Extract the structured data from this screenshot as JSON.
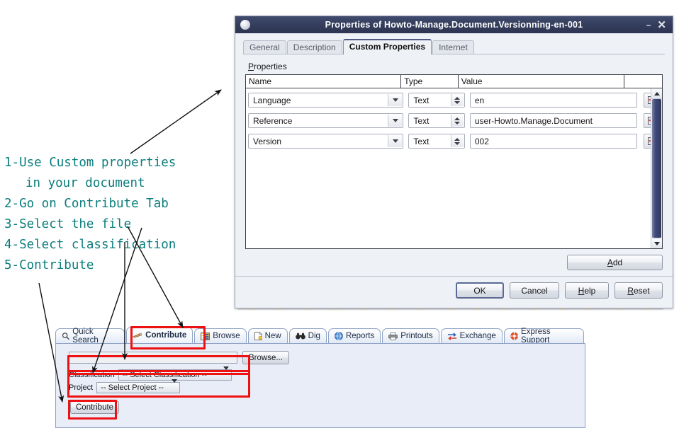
{
  "annotations": {
    "lines": [
      "1-Use Custom properties",
      "in your document",
      "2-Go on Contribute Tab",
      "3-Select the file",
      "4-Select classification",
      "5-Contribute"
    ],
    "color": "#0b7d7d"
  },
  "dialog": {
    "title": "Properties of Howto-Manage.Document.Versionning-en-001",
    "window_icon": "document-icon",
    "minimize_label": "–",
    "close_label": "✕",
    "tabs": [
      {
        "label": "General",
        "active": false
      },
      {
        "label": "Description",
        "active": false
      },
      {
        "label": "Custom Properties",
        "active": true
      },
      {
        "label": "Internet",
        "active": false
      }
    ],
    "group_label": "Properties",
    "group_label_mnemonic": "P",
    "columns": [
      "Name",
      "Type",
      "Value",
      ""
    ],
    "rows": [
      {
        "name": "Language",
        "type": "Text",
        "value": "en"
      },
      {
        "name": "Reference",
        "type": "Text",
        "value": "user-Howto.Manage.Document"
      },
      {
        "name": "Version",
        "type": "Text",
        "value": "002"
      }
    ],
    "row_button_icon": "grid-table-icon",
    "add_label": "Add",
    "add_mnemonic": "A",
    "footer_buttons": [
      {
        "label": "OK",
        "mnemonic": "",
        "default": true
      },
      {
        "label": "Cancel",
        "mnemonic": "",
        "default": false
      },
      {
        "label": "Help",
        "mnemonic": "H",
        "default": false
      },
      {
        "label": "Reset",
        "mnemonic": "R",
        "default": false
      }
    ],
    "scrollbar": {
      "up_icon": "scroll-up-arrow-icon",
      "down_icon": "scroll-down-arrow-icon"
    }
  },
  "app": {
    "tabs": [
      {
        "label": "Quick Search",
        "icon": "magnifier-icon",
        "active": false
      },
      {
        "label": "Contribute",
        "icon": "pencil-icon",
        "active": true
      },
      {
        "label": "Browse",
        "icon": "list-icon",
        "active": false
      },
      {
        "label": "New",
        "icon": "new-document-icon",
        "active": false
      },
      {
        "label": "Dig",
        "icon": "binoculars-icon",
        "active": false
      },
      {
        "label": "Reports",
        "icon": "globe-icon",
        "active": false
      },
      {
        "label": "Printouts",
        "icon": "printer-icon",
        "active": false
      },
      {
        "label": "Exchange",
        "icon": "exchange-arrows-icon",
        "active": false
      },
      {
        "label": "Express Support",
        "icon": "lifebuoy-icon",
        "active": false
      }
    ],
    "file_input_value": "",
    "browse_label": "Browse...",
    "classification_label": "Classification",
    "classification_value": "-- Select Classification --",
    "project_label": "Project",
    "project_value": "-- Select Project --",
    "contribute_label": "Contribute"
  },
  "highlight_color": "#ee1111"
}
